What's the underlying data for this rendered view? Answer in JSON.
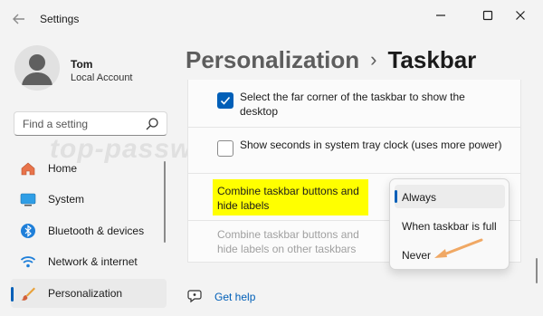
{
  "window": {
    "title": "Settings",
    "back_icon": "back-arrow-icon",
    "minimize_icon": "minimize-icon",
    "maximize_icon": "maximize-icon",
    "close_icon": "close-icon"
  },
  "user": {
    "name": "Tom",
    "account_type": "Local Account"
  },
  "search": {
    "placeholder": "Find a setting",
    "icon": "search-icon"
  },
  "sidebar": {
    "items": [
      {
        "label": "Home",
        "icon": "home-icon",
        "active": false
      },
      {
        "label": "System",
        "icon": "monitor-icon",
        "active": false
      },
      {
        "label": "Bluetooth & devices",
        "icon": "bluetooth-icon",
        "active": false
      },
      {
        "label": "Network & internet",
        "icon": "wifi-icon",
        "active": false
      },
      {
        "label": "Personalization",
        "icon": "brush-icon",
        "active": true
      }
    ]
  },
  "watermark": "top-password.co",
  "breadcrumb": {
    "parent": "Personalization",
    "separator": "›",
    "current": "Taskbar"
  },
  "options": [
    {
      "label": "Select the far corner of the taskbar to show the desktop",
      "checked": true
    },
    {
      "label": "Show seconds in system tray clock (uses more power)",
      "checked": false
    }
  ],
  "combine_setting": {
    "label": "Combine taskbar buttons and hide labels",
    "highlight_color": "#ffff00",
    "other_label": "Combine taskbar buttons and hide labels on other taskbars"
  },
  "dropdown": {
    "options": [
      {
        "label": "Always",
        "selected": true
      },
      {
        "label": "When taskbar is full",
        "selected": false
      },
      {
        "label": "Never",
        "selected": false
      }
    ]
  },
  "help": {
    "label": "Get help",
    "icon": "help-icon"
  },
  "colors": {
    "accent": "#005fb8",
    "annotation_arrow": "#f0a864"
  }
}
